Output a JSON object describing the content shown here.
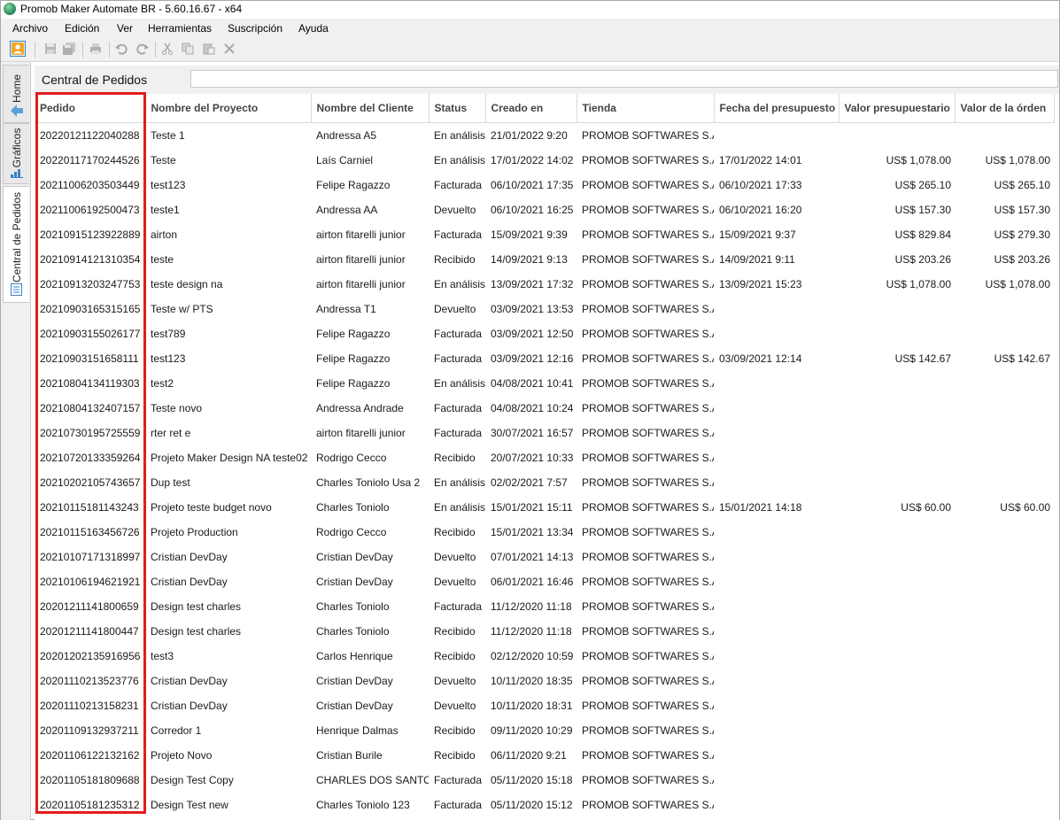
{
  "window": {
    "title": "Promob Maker Automate BR - 5.60.16.67 - x64",
    "app_icon": "promob-logo-icon"
  },
  "menu": [
    "Archivo",
    "Edición",
    "Ver",
    "Herramientas",
    "Suscripción",
    "Ayuda"
  ],
  "toolbar": {
    "icons": [
      "user-icon",
      "save-icon",
      "save-all-icon",
      "print-icon",
      "undo-icon",
      "redo-icon",
      "cut-icon",
      "copy-icon",
      "paste-icon",
      "delete-icon"
    ]
  },
  "vtabs": [
    {
      "label": "Home",
      "icon": "home-arrow-icon"
    },
    {
      "label": "Gráficos",
      "icon": "bar-chart-icon"
    },
    {
      "label": "Central de Pedidos",
      "icon": "document-icon"
    }
  ],
  "panel": {
    "title": "Central de Pedidos",
    "search_value": ""
  },
  "table": {
    "columns": [
      "Pedido",
      "Nombre del Proyecto",
      "Nombre del Cliente",
      "Status",
      "Creado en",
      "Tienda",
      "Fecha del presupuesto",
      "Valor presupuestario",
      "Valor de la órden"
    ],
    "rows": [
      [
        "20220121122040288",
        "Teste 1",
        "Andressa A5",
        "En análisis",
        "21/01/2022 9:20",
        "PROMOB SOFTWARES S.A...",
        "",
        "",
        ""
      ],
      [
        "20220117170244526",
        "Teste",
        "Laís Carniel",
        "En análisis",
        "17/01/2022 14:02",
        "PROMOB SOFTWARES S.A...",
        "17/01/2022 14:01",
        "US$ 1,078.00",
        "US$ 1,078.00"
      ],
      [
        "20211006203503449",
        "test123",
        "Felipe Ragazzo",
        "Facturada",
        "06/10/2021 17:35",
        "PROMOB SOFTWARES S.A...",
        "06/10/2021 17:33",
        "US$ 265.10",
        "US$ 265.10"
      ],
      [
        "20211006192500473",
        "teste1",
        "Andressa AA",
        "Devuelto",
        "06/10/2021 16:25",
        "PROMOB SOFTWARES S.A...",
        "06/10/2021 16:20",
        "US$ 157.30",
        "US$ 157.30"
      ],
      [
        "20210915123922889",
        "airton",
        "airton fitarelli junior",
        "Facturada",
        "15/09/2021 9:39",
        "PROMOB SOFTWARES S.A...",
        "15/09/2021 9:37",
        "US$ 829.84",
        "US$ 279.30"
      ],
      [
        "20210914121310354",
        "teste",
        "airton fitarelli junior",
        "Recibido",
        "14/09/2021 9:13",
        "PROMOB SOFTWARES S.A...",
        "14/09/2021 9:11",
        "US$ 203.26",
        "US$ 203.26"
      ],
      [
        "20210913203247753",
        "teste design na",
        "airton fitarelli junior",
        "En análisis",
        "13/09/2021 17:32",
        "PROMOB SOFTWARES S.A...",
        "13/09/2021 15:23",
        "US$ 1,078.00",
        "US$ 1,078.00"
      ],
      [
        "20210903165315165",
        "Teste w/ PTS",
        "Andressa T1",
        "Devuelto",
        "03/09/2021 13:53",
        "PROMOB SOFTWARES S.A...",
        "",
        "",
        ""
      ],
      [
        "20210903155026177",
        "test789",
        "Felipe Ragazzo",
        "Facturada",
        "03/09/2021 12:50",
        "PROMOB SOFTWARES S.A...",
        "",
        "",
        ""
      ],
      [
        "20210903151658111",
        "test123",
        "Felipe Ragazzo",
        "Facturada",
        "03/09/2021 12:16",
        "PROMOB SOFTWARES S.A...",
        "03/09/2021 12:14",
        "US$ 142.67",
        "US$ 142.67"
      ],
      [
        "20210804134119303",
        "test2",
        "Felipe Ragazzo",
        "En análisis",
        "04/08/2021 10:41",
        "PROMOB SOFTWARES S.A...",
        "",
        "",
        ""
      ],
      [
        "20210804132407157",
        "Teste novo",
        "Andressa Andrade",
        "Facturada",
        "04/08/2021 10:24",
        "PROMOB SOFTWARES S.A...",
        "",
        "",
        ""
      ],
      [
        "20210730195725559",
        "rter ret e",
        "airton fitarelli junior",
        "Facturada",
        "30/07/2021 16:57",
        "PROMOB SOFTWARES S.A...",
        "",
        "",
        ""
      ],
      [
        "20210720133359264",
        "Projeto Maker Design NA teste02",
        "Rodrigo Cecco",
        "Recibido",
        "20/07/2021 10:33",
        "PROMOB SOFTWARES S.A...",
        "",
        "",
        ""
      ],
      [
        "20210202105743657",
        "Dup test",
        "Charles Toniolo Usa 2",
        "En análisis",
        "02/02/2021 7:57",
        "PROMOB SOFTWARES S.A...",
        "",
        "",
        ""
      ],
      [
        "20210115181143243",
        "Projeto teste budget novo",
        "Charles Toniolo",
        "En análisis",
        "15/01/2021 15:11",
        "PROMOB SOFTWARES S.A...",
        "15/01/2021 14:18",
        "US$ 60.00",
        "US$ 60.00"
      ],
      [
        "20210115163456726",
        "Projeto Production",
        "Rodrigo Cecco",
        "Recibido",
        "15/01/2021 13:34",
        "PROMOB SOFTWARES S.A...",
        "",
        "",
        ""
      ],
      [
        "20210107171318997",
        "Cristian DevDay",
        "Cristian DevDay",
        "Devuelto",
        "07/01/2021 14:13",
        "PROMOB SOFTWARES S.A...",
        "",
        "",
        ""
      ],
      [
        "20210106194621921",
        "Cristian DevDay",
        "Cristian DevDay",
        "Devuelto",
        "06/01/2021 16:46",
        "PROMOB SOFTWARES S.A...",
        "",
        "",
        ""
      ],
      [
        "20201211141800659",
        "Design test charles",
        "Charles Toniolo",
        "Facturada",
        "11/12/2020 11:18",
        "PROMOB SOFTWARES S.A...",
        "",
        "",
        ""
      ],
      [
        "20201211141800447",
        "Design test charles",
        "Charles Toniolo",
        "Recibido",
        "11/12/2020 11:18",
        "PROMOB SOFTWARES S.A...",
        "",
        "",
        ""
      ],
      [
        "20201202135916956",
        "test3",
        "Carlos Henrique",
        "Recibido",
        "02/12/2020 10:59",
        "PROMOB SOFTWARES S.A...",
        "",
        "",
        ""
      ],
      [
        "20201110213523776",
        "Cristian DevDay",
        "Cristian DevDay",
        "Devuelto",
        "10/11/2020 18:35",
        "PROMOB SOFTWARES S.A...",
        "",
        "",
        ""
      ],
      [
        "20201110213158231",
        "Cristian DevDay",
        "Cristian DevDay",
        "Devuelto",
        "10/11/2020 18:31",
        "PROMOB SOFTWARES S.A...",
        "",
        "",
        ""
      ],
      [
        "20201109132937211",
        "Corredor 1",
        "Henrique Dalmas",
        "Recibido",
        "09/11/2020 10:29",
        "PROMOB SOFTWARES S.A...",
        "",
        "",
        ""
      ],
      [
        "20201106122132162",
        "Projeto Novo",
        "Cristian Burile",
        "Recibido",
        "06/11/2020 9:21",
        "PROMOB SOFTWARES S.A...",
        "",
        "",
        ""
      ],
      [
        "20201105181809688",
        "Design Test Copy",
        "CHARLES DOS SANTOS",
        "Facturada",
        "05/11/2020 15:18",
        "PROMOB SOFTWARES S.A...",
        "",
        "",
        ""
      ],
      [
        "20201105181235312",
        "Design Test new",
        "Charles Toniolo 123",
        "Facturada",
        "05/11/2020 15:12",
        "PROMOB SOFTWARES S.A...",
        "",
        "",
        ""
      ]
    ]
  },
  "highlight": {
    "column": "Pedido",
    "color": "#e11d1d"
  }
}
